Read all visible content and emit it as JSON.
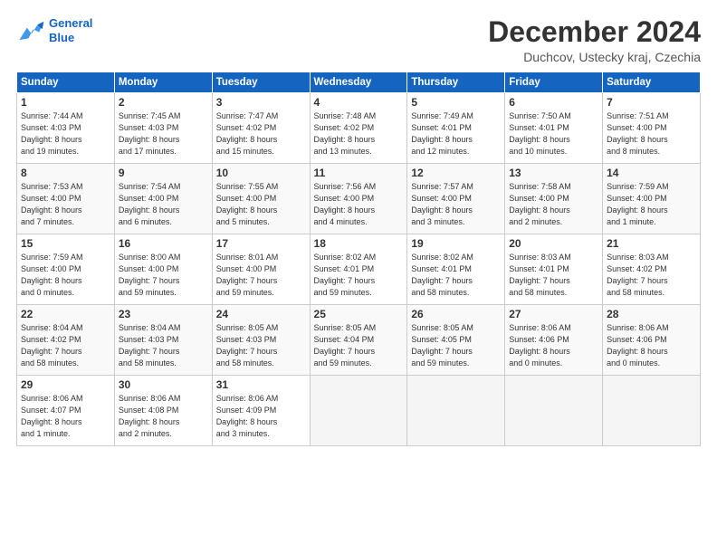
{
  "logo": {
    "line1": "General",
    "line2": "Blue"
  },
  "title": "December 2024",
  "subtitle": "Duchcov, Ustecky kraj, Czechia",
  "columns": [
    "Sunday",
    "Monday",
    "Tuesday",
    "Wednesday",
    "Thursday",
    "Friday",
    "Saturday"
  ],
  "weeks": [
    [
      {
        "day": "1",
        "detail": "Sunrise: 7:44 AM\nSunset: 4:03 PM\nDaylight: 8 hours\nand 19 minutes."
      },
      {
        "day": "2",
        "detail": "Sunrise: 7:45 AM\nSunset: 4:03 PM\nDaylight: 8 hours\nand 17 minutes."
      },
      {
        "day": "3",
        "detail": "Sunrise: 7:47 AM\nSunset: 4:02 PM\nDaylight: 8 hours\nand 15 minutes."
      },
      {
        "day": "4",
        "detail": "Sunrise: 7:48 AM\nSunset: 4:02 PM\nDaylight: 8 hours\nand 13 minutes."
      },
      {
        "day": "5",
        "detail": "Sunrise: 7:49 AM\nSunset: 4:01 PM\nDaylight: 8 hours\nand 12 minutes."
      },
      {
        "day": "6",
        "detail": "Sunrise: 7:50 AM\nSunset: 4:01 PM\nDaylight: 8 hours\nand 10 minutes."
      },
      {
        "day": "7",
        "detail": "Sunrise: 7:51 AM\nSunset: 4:00 PM\nDaylight: 8 hours\nand 8 minutes."
      }
    ],
    [
      {
        "day": "8",
        "detail": "Sunrise: 7:53 AM\nSunset: 4:00 PM\nDaylight: 8 hours\nand 7 minutes."
      },
      {
        "day": "9",
        "detail": "Sunrise: 7:54 AM\nSunset: 4:00 PM\nDaylight: 8 hours\nand 6 minutes."
      },
      {
        "day": "10",
        "detail": "Sunrise: 7:55 AM\nSunset: 4:00 PM\nDaylight: 8 hours\nand 5 minutes."
      },
      {
        "day": "11",
        "detail": "Sunrise: 7:56 AM\nSunset: 4:00 PM\nDaylight: 8 hours\nand 4 minutes."
      },
      {
        "day": "12",
        "detail": "Sunrise: 7:57 AM\nSunset: 4:00 PM\nDaylight: 8 hours\nand 3 minutes."
      },
      {
        "day": "13",
        "detail": "Sunrise: 7:58 AM\nSunset: 4:00 PM\nDaylight: 8 hours\nand 2 minutes."
      },
      {
        "day": "14",
        "detail": "Sunrise: 7:59 AM\nSunset: 4:00 PM\nDaylight: 8 hours\nand 1 minute."
      }
    ],
    [
      {
        "day": "15",
        "detail": "Sunrise: 7:59 AM\nSunset: 4:00 PM\nDaylight: 8 hours\nand 0 minutes."
      },
      {
        "day": "16",
        "detail": "Sunrise: 8:00 AM\nSunset: 4:00 PM\nDaylight: 7 hours\nand 59 minutes."
      },
      {
        "day": "17",
        "detail": "Sunrise: 8:01 AM\nSunset: 4:00 PM\nDaylight: 7 hours\nand 59 minutes."
      },
      {
        "day": "18",
        "detail": "Sunrise: 8:02 AM\nSunset: 4:01 PM\nDaylight: 7 hours\nand 59 minutes."
      },
      {
        "day": "19",
        "detail": "Sunrise: 8:02 AM\nSunset: 4:01 PM\nDaylight: 7 hours\nand 58 minutes."
      },
      {
        "day": "20",
        "detail": "Sunrise: 8:03 AM\nSunset: 4:01 PM\nDaylight: 7 hours\nand 58 minutes."
      },
      {
        "day": "21",
        "detail": "Sunrise: 8:03 AM\nSunset: 4:02 PM\nDaylight: 7 hours\nand 58 minutes."
      }
    ],
    [
      {
        "day": "22",
        "detail": "Sunrise: 8:04 AM\nSunset: 4:02 PM\nDaylight: 7 hours\nand 58 minutes."
      },
      {
        "day": "23",
        "detail": "Sunrise: 8:04 AM\nSunset: 4:03 PM\nDaylight: 7 hours\nand 58 minutes."
      },
      {
        "day": "24",
        "detail": "Sunrise: 8:05 AM\nSunset: 4:03 PM\nDaylight: 7 hours\nand 58 minutes."
      },
      {
        "day": "25",
        "detail": "Sunrise: 8:05 AM\nSunset: 4:04 PM\nDaylight: 7 hours\nand 59 minutes."
      },
      {
        "day": "26",
        "detail": "Sunrise: 8:05 AM\nSunset: 4:05 PM\nDaylight: 7 hours\nand 59 minutes."
      },
      {
        "day": "27",
        "detail": "Sunrise: 8:06 AM\nSunset: 4:06 PM\nDaylight: 8 hours\nand 0 minutes."
      },
      {
        "day": "28",
        "detail": "Sunrise: 8:06 AM\nSunset: 4:06 PM\nDaylight: 8 hours\nand 0 minutes."
      }
    ],
    [
      {
        "day": "29",
        "detail": "Sunrise: 8:06 AM\nSunset: 4:07 PM\nDaylight: 8 hours\nand 1 minute."
      },
      {
        "day": "30",
        "detail": "Sunrise: 8:06 AM\nSunset: 4:08 PM\nDaylight: 8 hours\nand 2 minutes."
      },
      {
        "day": "31",
        "detail": "Sunrise: 8:06 AM\nSunset: 4:09 PM\nDaylight: 8 hours\nand 3 minutes."
      },
      {
        "day": "",
        "detail": ""
      },
      {
        "day": "",
        "detail": ""
      },
      {
        "day": "",
        "detail": ""
      },
      {
        "day": "",
        "detail": ""
      }
    ]
  ]
}
